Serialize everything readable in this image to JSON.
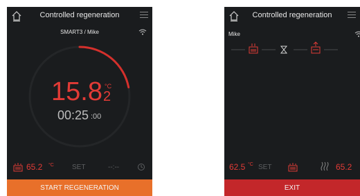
{
  "screen_a": {
    "header": {
      "title": "Controlled regeneration"
    },
    "subtitle": "SMART3 / Mike",
    "temperature": {
      "integer": "15.8",
      "decimal": "2",
      "unit": "°C"
    },
    "timer": {
      "main": "00:25",
      "seconds": ":00"
    },
    "bottom": {
      "temp_value": "65.2",
      "temp_unit": "°C",
      "set_label": "SET",
      "time_value": "--:--"
    },
    "action": {
      "label": "START REGENERATION",
      "color": "#e8702a"
    },
    "dial_progress": 0.22
  },
  "screen_b": {
    "header": {
      "title": "Controlled regeneration"
    },
    "user_label": "Mike",
    "status": {
      "left_value": "62.5",
      "left_unit": "°C",
      "set_label": "SET",
      "right_value": "65.2"
    },
    "action": {
      "label": "EXIT",
      "color": "#c3272a"
    }
  },
  "colors": {
    "accent_red": "#e23b36",
    "panel_bg": "#1a1c1e",
    "muted": "#5d5f61"
  }
}
